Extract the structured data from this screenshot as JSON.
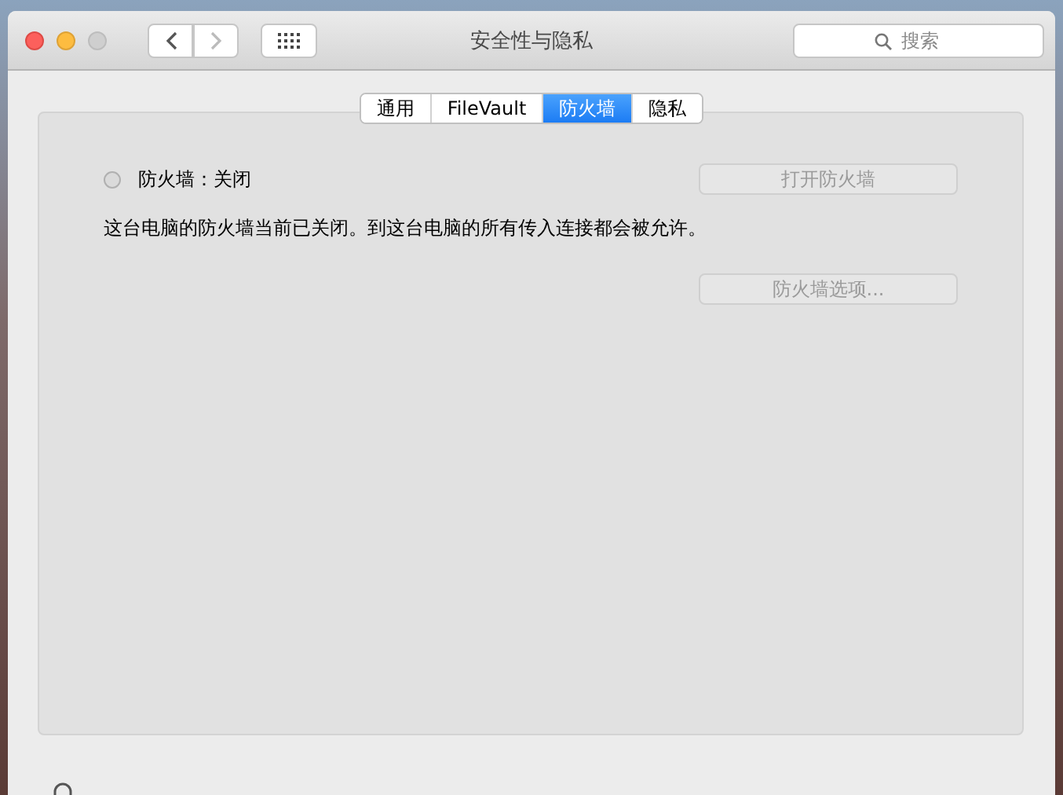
{
  "window": {
    "title": "安全性与隐私"
  },
  "search": {
    "placeholder": "搜索"
  },
  "tabs": [
    {
      "label": "通用",
      "selected": false
    },
    {
      "label": "FileVault",
      "selected": false
    },
    {
      "label": "防火墙",
      "selected": true
    },
    {
      "label": "隐私",
      "selected": false
    }
  ],
  "firewall": {
    "status_label": "防火墙：关闭",
    "on": false,
    "description": "这台电脑的防火墙当前已关闭。到这台电脑的所有传入连接都会被允许。",
    "buttons": [
      {
        "label": "打开防火墙",
        "disabled": true
      },
      {
        "label": "防火墙选项...",
        "disabled": true
      }
    ]
  }
}
